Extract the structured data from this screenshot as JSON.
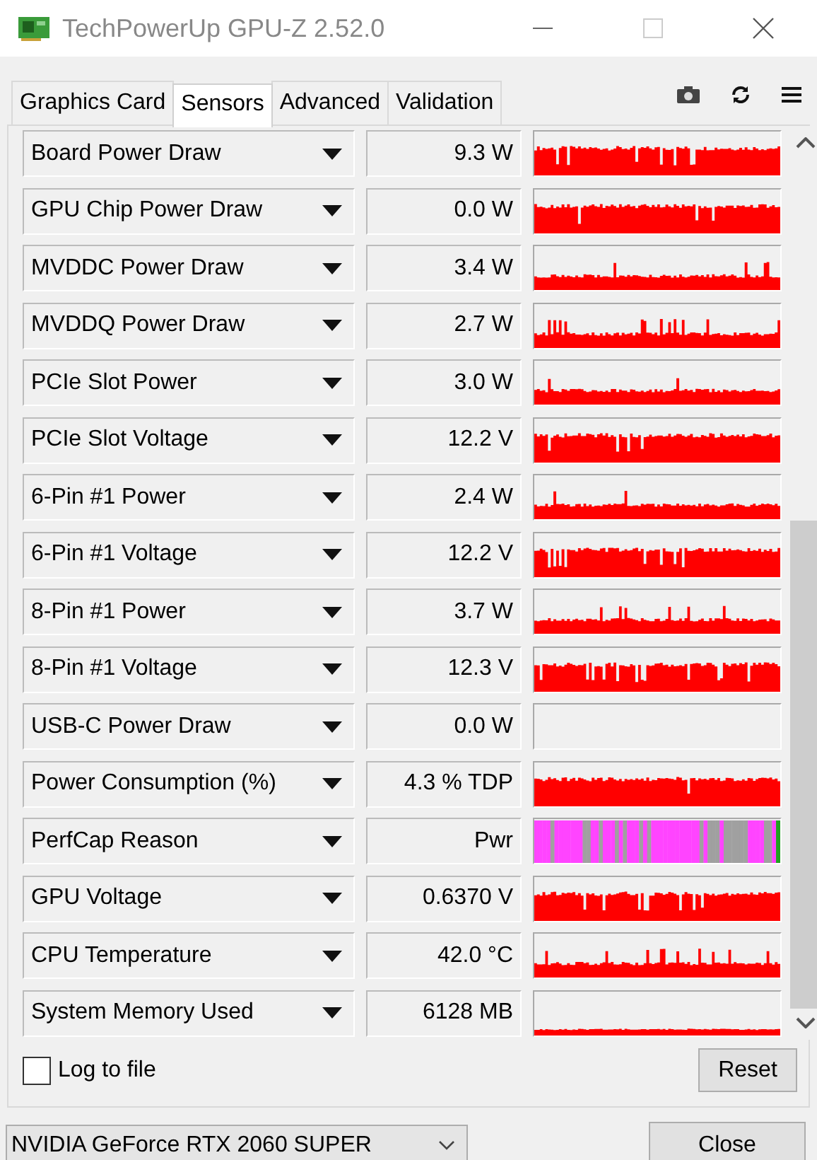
{
  "window": {
    "title": "TechPowerUp GPU-Z 2.52.0"
  },
  "tabs": [
    {
      "label": "Graphics Card",
      "selected": false
    },
    {
      "label": "Sensors",
      "selected": true
    },
    {
      "label": "Advanced",
      "selected": false
    },
    {
      "label": "Validation",
      "selected": false
    }
  ],
  "sensors": [
    {
      "name": "Board Power Draw",
      "value": "9.3 W",
      "kind": "high"
    },
    {
      "name": "GPU Chip Power Draw",
      "value": "0.0 W",
      "kind": "high"
    },
    {
      "name": "MVDDC Power Draw",
      "value": "3.4 W",
      "kind": "low"
    },
    {
      "name": "MVDDQ Power Draw",
      "value": "2.7 W",
      "kind": "low"
    },
    {
      "name": "PCIe Slot Power",
      "value": "3.0 W",
      "kind": "low"
    },
    {
      "name": "PCIe Slot Voltage",
      "value": "12.2 V",
      "kind": "high"
    },
    {
      "name": "6-Pin #1 Power",
      "value": "2.4 W",
      "kind": "low"
    },
    {
      "name": "6-Pin #1 Voltage",
      "value": "12.2 V",
      "kind": "high"
    },
    {
      "name": "8-Pin #1 Power",
      "value": "3.7 W",
      "kind": "low"
    },
    {
      "name": "8-Pin #1 Voltage",
      "value": "12.3 V",
      "kind": "high"
    },
    {
      "name": "USB-C Power Draw",
      "value": "0.0 W",
      "kind": "empty"
    },
    {
      "name": "Power Consumption (%)",
      "value": "4.3 % TDP",
      "kind": "high"
    },
    {
      "name": "PerfCap Reason",
      "value": "Pwr",
      "kind": "perfcap"
    },
    {
      "name": "GPU Voltage",
      "value": "0.6370 V",
      "kind": "high"
    },
    {
      "name": "CPU Temperature",
      "value": "42.0 °C",
      "kind": "low"
    },
    {
      "name": "System Memory Used",
      "value": "6128 MB",
      "kind": "base"
    }
  ],
  "log_to_file": {
    "label": "Log to file",
    "checked": false
  },
  "reset_button": "Reset",
  "gpu_select": {
    "value": "NVIDIA GeForce RTX 2060 SUPER"
  },
  "close_button": "Close"
}
